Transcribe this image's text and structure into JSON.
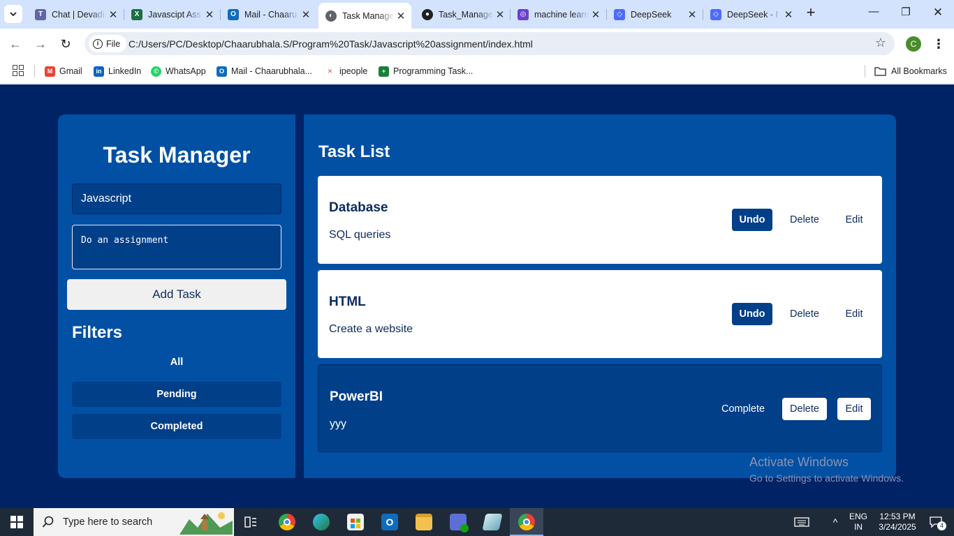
{
  "browser": {
    "tabs": [
      {
        "title": "Chat | Devadi",
        "fav_color": "#6264a7",
        "fav_glyph": "T"
      },
      {
        "title": "Javascipt Ass",
        "fav_color": "#1d6f42",
        "fav_glyph": "X"
      },
      {
        "title": "Mail - Chaaru",
        "fav_color": "#0f6cbd",
        "fav_glyph": "O"
      },
      {
        "title": "Task Manager",
        "fav_color": "#5f6368",
        "fav_glyph": "◐",
        "active": true
      },
      {
        "title": "Task_Manager",
        "fav_color": "#1f1f1f",
        "fav_glyph": "●"
      },
      {
        "title": "machine learn",
        "fav_color": "#6a3fd1",
        "fav_glyph": "◎"
      },
      {
        "title": "DeepSeek",
        "fav_color": "#4d6bfe",
        "fav_glyph": "◇"
      },
      {
        "title": "DeepSeek - I",
        "fav_color": "#4d6bfe",
        "fav_glyph": "◇"
      }
    ],
    "chip_label": "File",
    "url": "C:/Users/PC/Desktop/Chaarubhala.S/Program%20Task/Javascript%20assignment/index.html",
    "profile_initial": "C",
    "bookmarks": [
      {
        "label": "Gmail",
        "fav_color": "#ea4335",
        "fav_glyph": "M"
      },
      {
        "label": "LinkedIn",
        "fav_color": "#0a66c2",
        "fav_glyph": "in"
      },
      {
        "label": "WhatsApp",
        "fav_color": "#25d366",
        "fav_glyph": "✆"
      },
      {
        "label": "Mail - Chaarubhala...",
        "fav_color": "#0f6cbd",
        "fav_glyph": "O"
      },
      {
        "label": "ipeople",
        "fav_color": "#d9534f",
        "fav_glyph": "✕"
      },
      {
        "label": "Programming Task...",
        "fav_color": "#188038",
        "fav_glyph": "+"
      }
    ],
    "all_bookmarks": "All Bookmarks"
  },
  "app": {
    "title": "Task Manager",
    "title_input_value": "Javascript",
    "desc_input_value": "Do an assignment",
    "add_button": "Add Task",
    "filters_heading": "Filters",
    "filters": [
      {
        "label": "All",
        "boxed": false
      },
      {
        "label": "Pending",
        "boxed": true
      },
      {
        "label": "Completed",
        "boxed": true
      }
    ],
    "list_heading": "Task List",
    "tasks": [
      {
        "title": "Database",
        "description": "SQL queries",
        "completed": true,
        "toggle_label": "Undo",
        "delete_label": "Delete",
        "edit_label": "Edit"
      },
      {
        "title": "HTML",
        "description": "Create a website",
        "completed": true,
        "toggle_label": "Undo",
        "delete_label": "Delete",
        "edit_label": "Edit"
      },
      {
        "title": "PowerBI",
        "description": "yyy",
        "completed": false,
        "toggle_label": "Complete",
        "delete_label": "Delete",
        "edit_label": "Edit"
      }
    ]
  },
  "watermark": {
    "line1": "Activate Windows",
    "line2": "Go to Settings to activate Windows."
  },
  "taskbar": {
    "search_placeholder": "Type here to search",
    "lang_line1": "ENG",
    "lang_line2": "IN",
    "time": "12:53 PM",
    "date": "3/24/2025",
    "notification_count": "4"
  },
  "colors": {
    "page_bg": "#002366",
    "panel_bg": "#0250a3",
    "accent_dark": "#013f89",
    "text_dark": "#0c2b5e"
  }
}
